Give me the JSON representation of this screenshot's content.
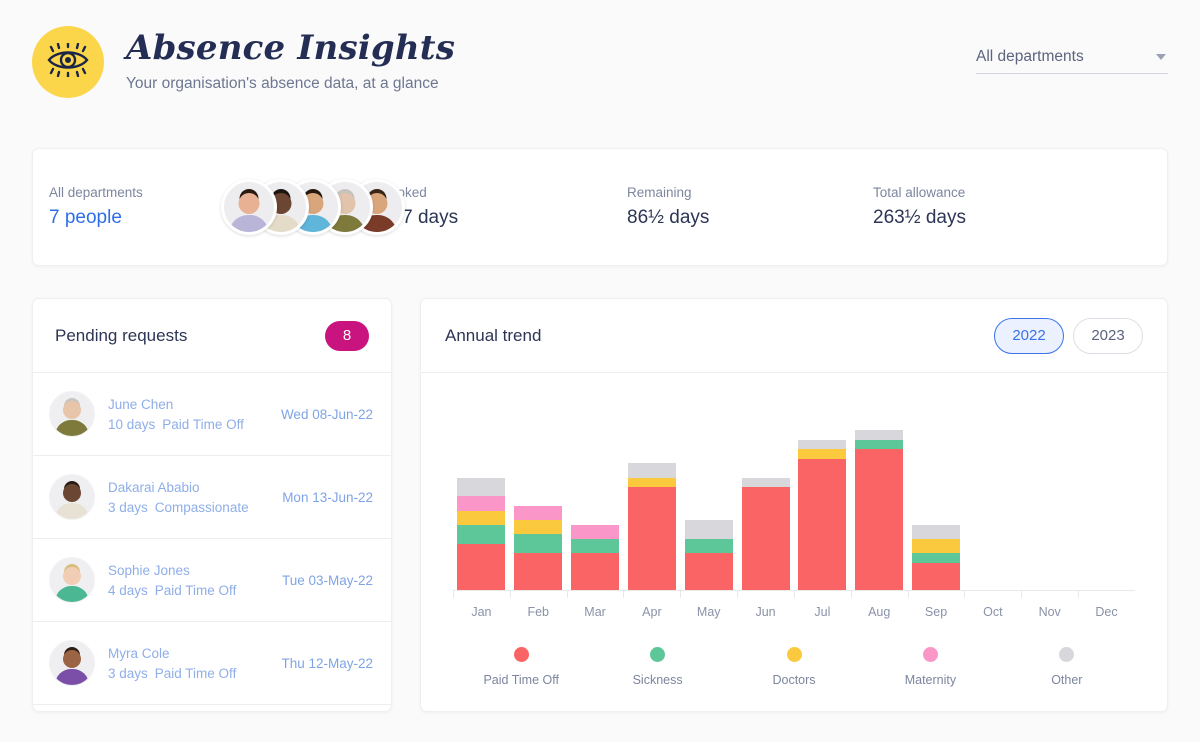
{
  "header": {
    "logo_icon": "eye-icon",
    "title": "Absence Insights",
    "subtitle": "Your organisation's absence data, at a glance",
    "department_select": {
      "value": "All departments",
      "caret_icon": "chevron-down-icon"
    }
  },
  "summary": {
    "department_label": "All departments",
    "people_value": "7 people",
    "avatars_count": 5,
    "stats": [
      {
        "label": "Booked",
        "value": "177 days"
      },
      {
        "label": "Remaining",
        "value": "86½ days"
      },
      {
        "label": "Total allowance",
        "value": "263½ days"
      }
    ]
  },
  "pending": {
    "title": "Pending requests",
    "count": "8",
    "requests": [
      {
        "name": "June Chen",
        "days": "10 days",
        "type": "Paid Time Off",
        "date": "Wed 08-Jun-22",
        "skin": "#E8C4A8",
        "hair": "#C9C4BE",
        "shirt": "#7E7A3C"
      },
      {
        "name": "Dakarai Ababio",
        "days": "3 days",
        "type": "Compassionate",
        "date": "Mon 13-Jun-22",
        "skin": "#6B4632",
        "hair": "#2A1C14",
        "shirt": "#E8E2D4"
      },
      {
        "name": "Sophie Jones",
        "days": "4 days",
        "type": "Paid Time Off",
        "date": "Tue 03-May-22",
        "skin": "#F0CDB4",
        "hair": "#D9BC7E",
        "shirt": "#4CB793"
      },
      {
        "name": "Myra Cole",
        "days": "3 days",
        "type": "Paid Time Off",
        "date": "Thu 12-May-22",
        "skin": "#9A6445",
        "hair": "#2E1E16",
        "shirt": "#7B4FA8"
      }
    ]
  },
  "trend": {
    "title": "Annual trend",
    "years": [
      {
        "label": "2022",
        "selected": true
      },
      {
        "label": "2023",
        "selected": false
      }
    ]
  },
  "chart_data": {
    "type": "bar",
    "stacked": true,
    "title": "Annual trend",
    "xlabel": "",
    "ylabel": "",
    "grid": false,
    "legend_position": "bottom",
    "ylim": [
      0,
      22
    ],
    "categories": [
      "Jan",
      "Feb",
      "Mar",
      "Apr",
      "May",
      "Jun",
      "Jul",
      "Aug",
      "Sep",
      "Oct",
      "Nov",
      "Dec"
    ],
    "series": [
      {
        "name": "Paid Time Off",
        "color": "#FB6464",
        "values": [
          5,
          4,
          4,
          11,
          4,
          11,
          14,
          15,
          3,
          0,
          0,
          0
        ]
      },
      {
        "name": "Sickness",
        "color": "#5DC79A",
        "values": [
          2,
          2,
          1.5,
          0,
          1.5,
          0,
          0,
          1,
          1,
          0,
          0,
          0
        ]
      },
      {
        "name": "Doctors",
        "color": "#FBC93D",
        "values": [
          1.5,
          1.5,
          0,
          1,
          0,
          0,
          1,
          0,
          1.5,
          0,
          0,
          0
        ]
      },
      {
        "name": "Maternity",
        "color": "#FB97C8",
        "values": [
          1.5,
          1.5,
          1.5,
          0,
          0,
          0,
          0,
          0,
          0,
          0,
          0,
          0
        ]
      },
      {
        "name": "Other",
        "color": "#D8D8DC",
        "values": [
          2,
          0,
          0,
          1.5,
          2,
          1,
          1,
          1,
          1.5,
          0,
          0,
          0
        ]
      }
    ]
  }
}
